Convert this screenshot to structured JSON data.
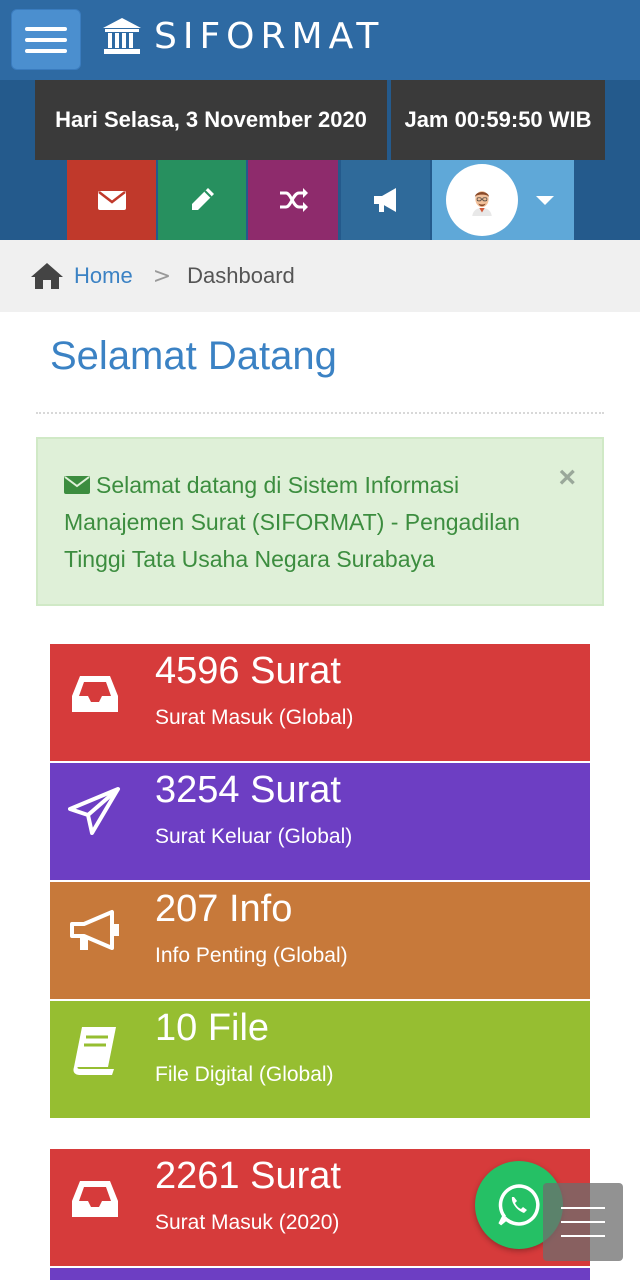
{
  "header": {
    "brand": "SIFORMAT"
  },
  "datetime": {
    "day": "Hari Selasa, 3 November 2020",
    "time": "Jam 00:59:50 WIB"
  },
  "toolbar": {
    "icons": [
      "envelope-icon",
      "pencil-icon",
      "shuffle-icon",
      "bullhorn-icon",
      "avatar"
    ]
  },
  "breadcrumb": {
    "home": "Home",
    "separator": ">",
    "current": "Dashboard"
  },
  "page": {
    "title": "Selamat Datang"
  },
  "alert": {
    "message": "Selamat datang di Sistem Informasi Manajemen Surat (SIFORMAT) - Pengadilan Tinggi Tata Usaha Negara Surabaya",
    "close": "×"
  },
  "stats": [
    {
      "value": "4596 Surat",
      "label": "Surat Masuk (Global)",
      "icon": "inbox-icon",
      "color": "#d63b3b"
    },
    {
      "value": "3254 Surat",
      "label": "Surat Keluar (Global)",
      "icon": "paper-plane-icon",
      "color": "#6d3ec3"
    },
    {
      "value": "207 Info",
      "label": "Info Penting (Global)",
      "icon": "bullhorn-icon",
      "color": "#c7793a"
    },
    {
      "value": "10 File",
      "label": "File Digital (Global)",
      "icon": "book-icon",
      "color": "#96be31"
    },
    {
      "value": "2261 Surat",
      "label": "Surat Masuk (2020)",
      "icon": "inbox-icon",
      "color": "#d63b3b"
    }
  ]
}
